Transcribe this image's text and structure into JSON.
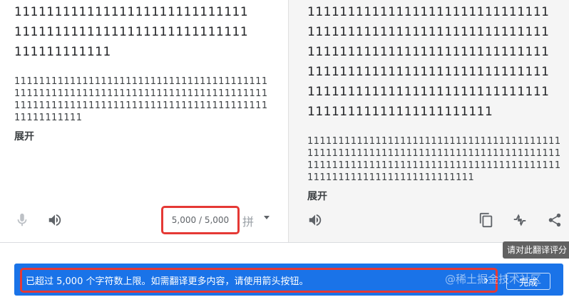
{
  "source": {
    "main_text": "1111111111111111111111111111111111111111111111111111111111111111111111",
    "sub_text": "11111111111111111111111111111111111111111111111111111111111111111111111111111111111111111111111111111111111111111111111111111111111111",
    "expand_label": "展开",
    "char_counter": "5,000 / 5,000",
    "ime_label": "拼"
  },
  "target": {
    "main_text": "11111111111111111111111111111111111111111111111111111111111111111111111111111111111111111111111111111111111111111111111111111111111111111111111111111111111111111111111111111",
    "sub_text": "111111111111111111111111111111111111111111111111111111111111111111111111111111111111111111111111111111111111111111111111111111111111111111111111111111",
    "expand_label": "展开"
  },
  "tooltip": {
    "text": "请对此翻译评分"
  },
  "banner": {
    "message": "已超过 5,000 个字符数上限。如需翻译更多内容，请使用箭头按钮。",
    "arrow": "›",
    "done_label": "完成",
    "watermark": "@稀土掘金技术社区"
  },
  "icons": {
    "source_toolbar": [
      "microphone-icon",
      "speaker-icon",
      "dropdown-caret-icon"
    ],
    "target_toolbar": [
      "speaker-icon",
      "copy-icon",
      "rate-translation-icon",
      "share-icon"
    ]
  },
  "colors": {
    "banner_blue": "#1a73e8",
    "highlight_red": "#e53935",
    "tooltip_gray": "#616161",
    "target_bg": "#f5f5f5"
  }
}
